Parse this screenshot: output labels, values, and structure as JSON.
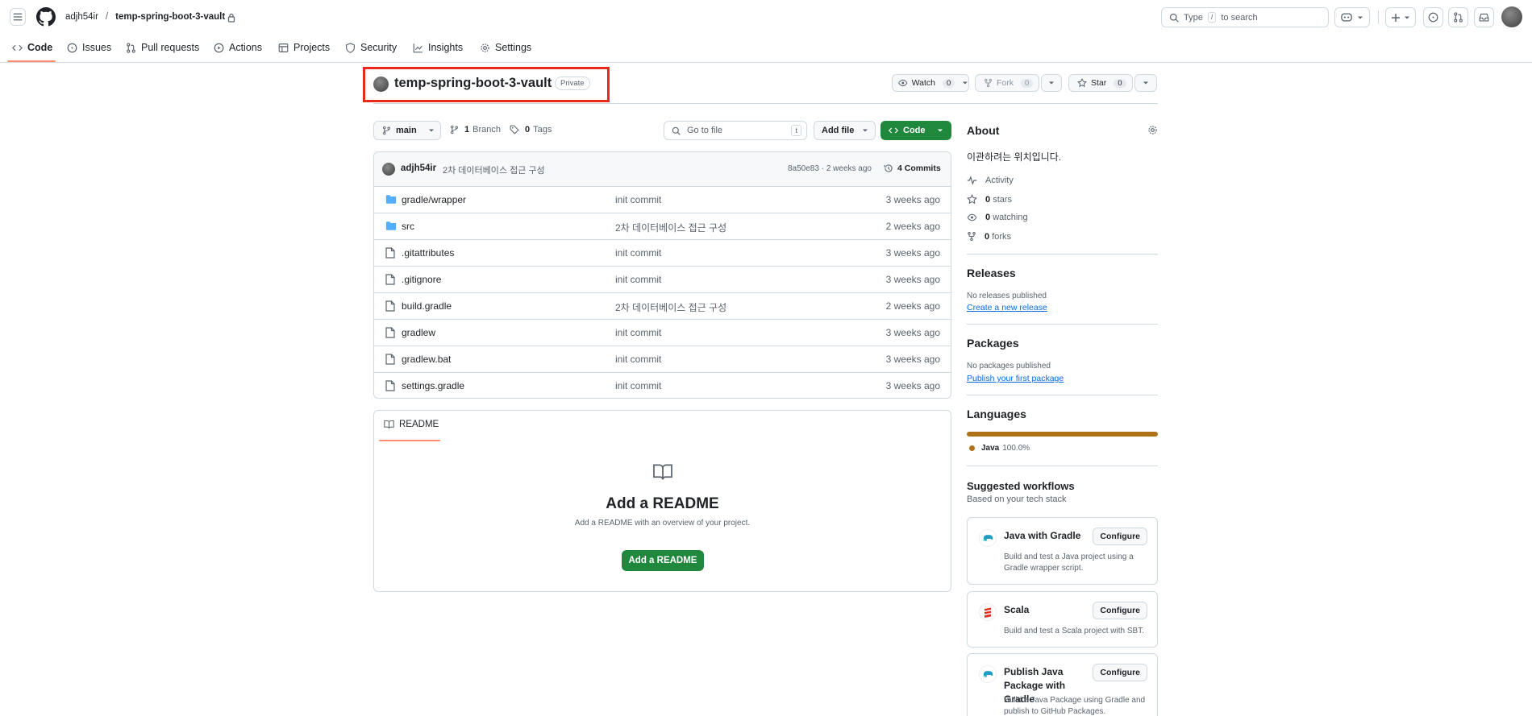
{
  "header": {
    "owner": "adjh54ir",
    "separator": "/",
    "repo": "temp-spring-boot-3-vault",
    "search_prefix": "Type",
    "search_key": "/",
    "search_suffix": "to search"
  },
  "nav": {
    "tabs": [
      {
        "label": "Code"
      },
      {
        "label": "Issues"
      },
      {
        "label": "Pull requests"
      },
      {
        "label": "Actions"
      },
      {
        "label": "Projects"
      },
      {
        "label": "Security"
      },
      {
        "label": "Insights"
      },
      {
        "label": "Settings"
      }
    ]
  },
  "repo_head": {
    "name": "temp-spring-boot-3-vault",
    "visibility": "Private",
    "watch_label": "Watch",
    "watch_count": "0",
    "fork_label": "Fork",
    "fork_count": "0",
    "star_label": "Star",
    "star_count": "0"
  },
  "toolbar": {
    "branch": "main",
    "branches_count": "1",
    "branches_label": "Branch",
    "tags_count": "0",
    "tags_label": "Tags",
    "goto_placeholder": "Go to file",
    "goto_key": "t",
    "add_file": "Add file",
    "code": "Code"
  },
  "commit_bar": {
    "author": "adjh54ir",
    "message": "2차 데이터베이스 접근 구성",
    "hash_time": "8a50e83 · 2 weeks ago",
    "commits": "4 Commits"
  },
  "files": [
    {
      "name": "gradle/wrapper",
      "type": "folder",
      "message": "init commit",
      "date": "3 weeks ago"
    },
    {
      "name": "src",
      "type": "folder",
      "message": "2차 데이터베이스 접근 구성",
      "date": "2 weeks ago"
    },
    {
      "name": ".gitattributes",
      "type": "file",
      "message": "init commit",
      "date": "3 weeks ago"
    },
    {
      "name": ".gitignore",
      "type": "file",
      "message": "init commit",
      "date": "3 weeks ago"
    },
    {
      "name": "build.gradle",
      "type": "file",
      "message": "2차 데이터베이스 접근 구성",
      "date": "2 weeks ago"
    },
    {
      "name": "gradlew",
      "type": "file",
      "message": "init commit",
      "date": "3 weeks ago"
    },
    {
      "name": "gradlew.bat",
      "type": "file",
      "message": "init commit",
      "date": "3 weeks ago"
    },
    {
      "name": "settings.gradle",
      "type": "file",
      "message": "init commit",
      "date": "3 weeks ago"
    }
  ],
  "readme": {
    "tab": "README",
    "title": "Add a README",
    "description": "Add a README with an overview of your project.",
    "button": "Add a README"
  },
  "about": {
    "title": "About",
    "description": "이관하려는 위치입니다.",
    "activity": "Activity",
    "stars_count": "0",
    "stars_label": "stars",
    "watching_count": "0",
    "watching_label": "watching",
    "forks_count": "0",
    "forks_label": "forks"
  },
  "releases": {
    "title": "Releases",
    "none": "No releases published",
    "link": "Create a new release"
  },
  "packages": {
    "title": "Packages",
    "none": "No packages published",
    "link": "Publish your first package"
  },
  "languages": {
    "title": "Languages",
    "items": [
      {
        "name": "Java",
        "percent": "100.0%",
        "fraction": 1.0,
        "color": "#b07219"
      }
    ]
  },
  "workflows": {
    "title": "Suggested workflows",
    "subtitle": "Based on your tech stack",
    "items": [
      {
        "name": "Java with Gradle",
        "desc": "Build and test a Java project using a Gradle wrapper script.",
        "button": "Configure"
      },
      {
        "name": "Scala",
        "desc": "Build and test a Scala project with SBT.",
        "button": "Configure"
      },
      {
        "name": "Publish Java Package with Gradle",
        "desc": "Build a Java Package using Gradle and publish to GitHub Packages.",
        "button": "Configure"
      }
    ]
  },
  "colors": {
    "accent": "#1f883d",
    "link": "#0969da",
    "highlight_box": "#e8291c",
    "tab_underline": "#fd8c73",
    "folder": "#54aeff"
  }
}
